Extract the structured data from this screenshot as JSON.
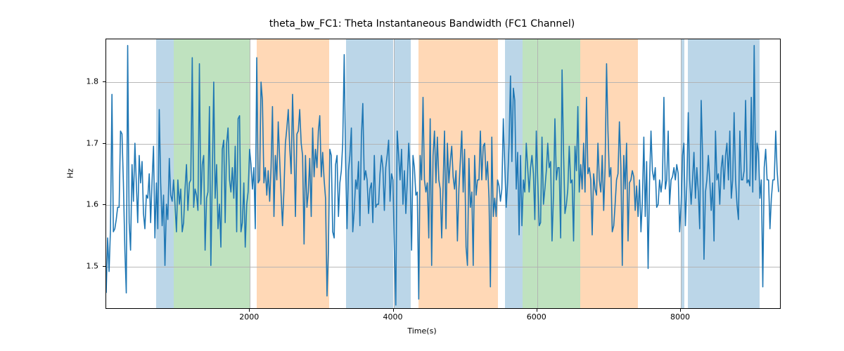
{
  "chart_data": {
    "type": "line",
    "title": "theta_bw_FC1: Theta Instantaneous Bandwidth (FC1 Channel)",
    "xlabel": "Time(s)",
    "ylabel": "Hz",
    "series_name": "theta_bw_FC1",
    "line_color": "#1f77b4",
    "xlim": [
      0,
      9400
    ],
    "ylim": [
      1.43,
      1.87
    ],
    "x_ticks": [
      2000,
      4000,
      6000,
      8000
    ],
    "y_ticks": [
      1.5,
      1.6,
      1.7,
      1.8
    ],
    "spans": [
      {
        "start": 700,
        "end": 940,
        "color": "#1f77b4"
      },
      {
        "start": 940,
        "end": 2000,
        "color": "#2ca02c"
      },
      {
        "start": 2100,
        "end": 3100,
        "color": "#ff7f0e"
      },
      {
        "start": 3340,
        "end": 4000,
        "color": "#1f77b4"
      },
      {
        "start": 4000,
        "end": 4240,
        "color": "#1f77b4"
      },
      {
        "start": 4350,
        "end": 5450,
        "color": "#ff7f0e"
      },
      {
        "start": 5550,
        "end": 5800,
        "color": "#1f77b4"
      },
      {
        "start": 5800,
        "end": 6600,
        "color": "#2ca02c"
      },
      {
        "start": 6600,
        "end": 7400,
        "color": "#ff7f0e"
      },
      {
        "start": 8000,
        "end": 8050,
        "color": "#1f77b4"
      },
      {
        "start": 8100,
        "end": 9100,
        "color": "#1f77b4"
      }
    ],
    "span_alpha": 0.3,
    "x": [
      0,
      20,
      40,
      60,
      80,
      100,
      120,
      140,
      160,
      180,
      200,
      220,
      240,
      260,
      280,
      300,
      320,
      340,
      360,
      380,
      400,
      420,
      440,
      460,
      480,
      500,
      520,
      540,
      560,
      580,
      600,
      620,
      640,
      660,
      680,
      700,
      720,
      740,
      760,
      780,
      800,
      820,
      840,
      860,
      880,
      900,
      920,
      940,
      960,
      980,
      1000,
      1020,
      1040,
      1060,
      1080,
      1100,
      1120,
      1140,
      1160,
      1180,
      1200,
      1220,
      1240,
      1260,
      1280,
      1300,
      1320,
      1340,
      1360,
      1380,
      1400,
      1420,
      1440,
      1460,
      1480,
      1500,
      1520,
      1540,
      1560,
      1580,
      1600,
      1620,
      1640,
      1660,
      1680,
      1700,
      1720,
      1740,
      1760,
      1780,
      1800,
      1820,
      1840,
      1860,
      1880,
      1900,
      1920,
      1940,
      1960,
      1980,
      2000,
      2020,
      2040,
      2060,
      2080,
      2100,
      2120,
      2140,
      2160,
      2180,
      2200,
      2220,
      2240,
      2260,
      2280,
      2300,
      2320,
      2340,
      2360,
      2380,
      2400,
      2420,
      2440,
      2460,
      2480,
      2500,
      2520,
      2540,
      2560,
      2580,
      2600,
      2620,
      2640,
      2660,
      2680,
      2700,
      2720,
      2740,
      2760,
      2780,
      2800,
      2820,
      2840,
      2860,
      2880,
      2900,
      2920,
      2940,
      2960,
      2980,
      3000,
      3020,
      3040,
      3060,
      3080,
      3100,
      3120,
      3140,
      3160,
      3180,
      3200,
      3220,
      3240,
      3260,
      3280,
      3300,
      3320,
      3340,
      3360,
      3380,
      3400,
      3420,
      3440,
      3460,
      3480,
      3500,
      3520,
      3540,
      3560,
      3580,
      3600,
      3620,
      3640,
      3660,
      3680,
      3700,
      3720,
      3740,
      3760,
      3780,
      3800,
      3820,
      3840,
      3860,
      3880,
      3900,
      3920,
      3940,
      3960,
      3980,
      4000,
      4020,
      4040,
      4060,
      4080,
      4100,
      4120,
      4140,
      4160,
      4180,
      4200,
      4220,
      4240,
      4260,
      4280,
      4300,
      4320,
      4340,
      4360,
      4380,
      4400,
      4420,
      4440,
      4460,
      4480,
      4500,
      4520,
      4540,
      4560,
      4580,
      4600,
      4620,
      4640,
      4660,
      4680,
      4700,
      4720,
      4740,
      4760,
      4780,
      4800,
      4820,
      4840,
      4860,
      4880,
      4900,
      4920,
      4940,
      4960,
      4980,
      5000,
      5020,
      5040,
      5060,
      5080,
      5100,
      5120,
      5140,
      5160,
      5180,
      5200,
      5220,
      5240,
      5260,
      5280,
      5300,
      5320,
      5340,
      5360,
      5380,
      5400,
      5420,
      5440,
      5460,
      5480,
      5500,
      5520,
      5540,
      5560,
      5580,
      5600,
      5620,
      5640,
      5660,
      5680,
      5700,
      5720,
      5740,
      5760,
      5780,
      5800,
      5820,
      5840,
      5860,
      5880,
      5900,
      5920,
      5940,
      5960,
      5980,
      6000,
      6020,
      6040,
      6060,
      6080,
      6100,
      6120,
      6140,
      6160,
      6180,
      6200,
      6220,
      6240,
      6260,
      6280,
      6300,
      6320,
      6340,
      6360,
      6380,
      6400,
      6420,
      6440,
      6460,
      6480,
      6500,
      6520,
      6540,
      6560,
      6580,
      6600,
      6620,
      6640,
      6660,
      6680,
      6700,
      6720,
      6740,
      6760,
      6780,
      6800,
      6820,
      6840,
      6860,
      6880,
      6900,
      6920,
      6940,
      6960,
      6980,
      7000,
      7020,
      7040,
      7060,
      7080,
      7100,
      7120,
      7140,
      7160,
      7180,
      7200,
      7220,
      7240,
      7260,
      7280,
      7300,
      7320,
      7340,
      7360,
      7380,
      7400,
      7420,
      7440,
      7460,
      7480,
      7500,
      7520,
      7540,
      7560,
      7580,
      7600,
      7620,
      7640,
      7660,
      7680,
      7700,
      7720,
      7740,
      7760,
      7780,
      7800,
      7820,
      7840,
      7860,
      7880,
      7900,
      7920,
      7940,
      7960,
      7980,
      8000,
      8020,
      8040,
      8060,
      8080,
      8100,
      8120,
      8140,
      8160,
      8180,
      8200,
      8220,
      8240,
      8260,
      8280,
      8300,
      8320,
      8340,
      8360,
      8380,
      8400,
      8420,
      8440,
      8460,
      8480,
      8500,
      8520,
      8540,
      8560,
      8580,
      8600,
      8620,
      8640,
      8660,
      8680,
      8700,
      8720,
      8740,
      8760,
      8780,
      8800,
      8820,
      8840,
      8860,
      8880,
      8900,
      8920,
      8940,
      8960,
      8980,
      9000,
      9020,
      9040,
      9060,
      9080,
      9100,
      9120,
      9140,
      9160,
      9180,
      9200,
      9220,
      9240,
      9260,
      9280,
      9300,
      9320,
      9340,
      9360,
      9380
    ],
    "y": [
      1.455,
      1.545,
      1.49,
      1.56,
      1.78,
      1.555,
      1.56,
      1.575,
      1.595,
      1.595,
      1.72,
      1.715,
      1.635,
      1.525,
      1.455,
      1.86,
      1.57,
      1.525,
      1.665,
      1.605,
      1.7,
      1.635,
      1.57,
      1.68,
      1.635,
      1.67,
      1.585,
      1.56,
      1.615,
      1.61,
      1.65,
      1.57,
      1.64,
      1.695,
      1.545,
      1.635,
      1.56,
      1.755,
      1.635,
      1.565,
      1.615,
      1.5,
      1.6,
      1.575,
      1.675,
      1.615,
      1.605,
      1.64,
      1.6,
      1.555,
      1.64,
      1.6,
      1.625,
      1.555,
      1.57,
      1.625,
      1.665,
      1.59,
      1.635,
      1.64,
      1.84,
      1.595,
      1.625,
      1.615,
      1.59,
      1.83,
      1.6,
      1.665,
      1.68,
      1.525,
      1.61,
      1.62,
      1.76,
      1.5,
      1.64,
      1.8,
      1.61,
      1.665,
      1.56,
      1.6,
      1.53,
      1.69,
      1.705,
      1.57,
      1.7,
      1.725,
      1.64,
      1.62,
      1.66,
      1.61,
      1.695,
      1.555,
      1.74,
      1.745,
      1.555,
      1.57,
      1.635,
      1.53,
      1.6,
      1.62,
      1.69,
      1.665,
      1.625,
      1.66,
      1.56,
      1.84,
      1.635,
      1.64,
      1.8,
      1.77,
      1.635,
      1.66,
      1.615,
      1.655,
      1.605,
      1.66,
      1.76,
      1.58,
      1.68,
      1.64,
      1.735,
      1.675,
      1.615,
      1.565,
      1.625,
      1.7,
      1.725,
      1.755,
      1.695,
      1.65,
      1.78,
      1.69,
      1.58,
      1.715,
      1.72,
      1.755,
      1.7,
      1.68,
      1.535,
      1.68,
      1.595,
      1.62,
      1.675,
      1.58,
      1.725,
      1.645,
      1.69,
      1.66,
      1.72,
      1.745,
      1.645,
      1.685,
      1.64,
      1.61,
      1.45,
      1.525,
      1.69,
      1.68,
      1.555,
      1.545,
      1.665,
      1.68,
      1.58,
      1.635,
      1.655,
      1.7,
      1.845,
      1.67,
      1.56,
      1.655,
      1.68,
      1.725,
      1.555,
      1.59,
      1.64,
      1.625,
      1.67,
      1.565,
      1.71,
      1.765,
      1.64,
      1.655,
      1.64,
      1.585,
      1.625,
      1.635,
      1.57,
      1.68,
      1.595,
      1.6,
      1.6,
      1.65,
      1.68,
      1.66,
      1.59,
      1.66,
      1.68,
      1.705,
      1.605,
      1.65,
      1.64,
      1.525,
      1.435,
      1.72,
      1.68,
      1.64,
      1.69,
      1.6,
      1.655,
      1.585,
      1.635,
      1.7,
      1.655,
      1.525,
      1.68,
      1.66,
      1.615,
      1.62,
      1.445,
      1.68,
      1.64,
      1.775,
      1.64,
      1.62,
      1.635,
      1.545,
      1.74,
      1.5,
      1.68,
      1.72,
      1.635,
      1.71,
      1.64,
      1.625,
      1.545,
      1.63,
      1.72,
      1.56,
      1.7,
      1.635,
      1.67,
      1.695,
      1.645,
      1.625,
      1.655,
      1.54,
      1.625,
      1.67,
      1.72,
      1.62,
      1.69,
      1.53,
      1.5,
      1.675,
      1.595,
      1.62,
      1.5,
      1.68,
      1.615,
      1.64,
      1.64,
      1.72,
      1.64,
      1.695,
      1.7,
      1.64,
      1.67,
      1.61,
      1.465,
      1.71,
      1.58,
      1.61,
      1.58,
      1.64,
      1.63,
      1.605,
      1.625,
      1.74,
      1.665,
      1.595,
      1.635,
      1.7,
      1.81,
      1.67,
      1.79,
      1.77,
      1.625,
      1.685,
      1.55,
      1.68,
      1.565,
      1.64,
      1.62,
      1.7,
      1.66,
      1.62,
      1.66,
      1.68,
      1.65,
      1.575,
      1.72,
      1.64,
      1.565,
      1.57,
      1.71,
      1.6,
      1.625,
      1.655,
      1.7,
      1.66,
      1.67,
      1.54,
      1.615,
      1.74,
      1.64,
      1.66,
      1.66,
      1.545,
      1.82,
      1.685,
      1.585,
      1.6,
      1.625,
      1.695,
      1.635,
      1.64,
      1.54,
      1.695,
      1.655,
      1.76,
      1.62,
      1.665,
      1.625,
      1.7,
      1.62,
      1.775,
      1.65,
      1.66,
      1.64,
      1.55,
      1.65,
      1.625,
      1.615,
      1.7,
      1.64,
      1.62,
      1.68,
      1.59,
      1.66,
      1.83,
      1.72,
      1.645,
      1.66,
      1.555,
      1.565,
      1.6,
      1.64,
      1.65,
      1.735,
      1.66,
      1.5,
      1.68,
      1.625,
      1.7,
      1.54,
      1.635,
      1.64,
      1.655,
      1.645,
      1.59,
      1.63,
      1.58,
      1.64,
      1.555,
      1.605,
      1.71,
      1.58,
      1.67,
      1.495,
      1.635,
      1.72,
      1.655,
      1.64,
      1.66,
      1.595,
      1.6,
      1.64,
      1.62,
      1.64,
      1.775,
      1.625,
      1.64,
      1.72,
      1.6,
      1.64,
      1.645,
      1.66,
      1.64,
      1.665,
      1.65,
      1.555,
      1.6,
      1.68,
      1.7,
      1.565,
      1.63,
      1.75,
      1.64,
      1.6,
      1.64,
      1.685,
      1.61,
      1.66,
      1.62,
      1.56,
      1.77,
      1.68,
      1.51,
      1.62,
      1.64,
      1.68,
      1.64,
      1.59,
      1.635,
      1.54,
      1.72,
      1.64,
      1.65,
      1.6,
      1.66,
      1.68,
      1.625,
      1.68,
      1.7,
      1.64,
      1.72,
      1.61,
      1.64,
      1.75,
      1.64,
      1.6,
      1.575,
      1.72,
      1.64,
      1.64,
      1.655,
      1.77,
      1.635,
      1.64,
      1.63,
      1.775,
      1.62,
      1.86,
      1.64,
      1.7,
      1.685,
      1.61,
      1.64,
      1.465,
      1.66,
      1.69,
      1.64,
      1.64,
      1.56,
      1.61,
      1.64,
      1.64,
      1.72,
      1.655,
      1.62
    ]
  }
}
